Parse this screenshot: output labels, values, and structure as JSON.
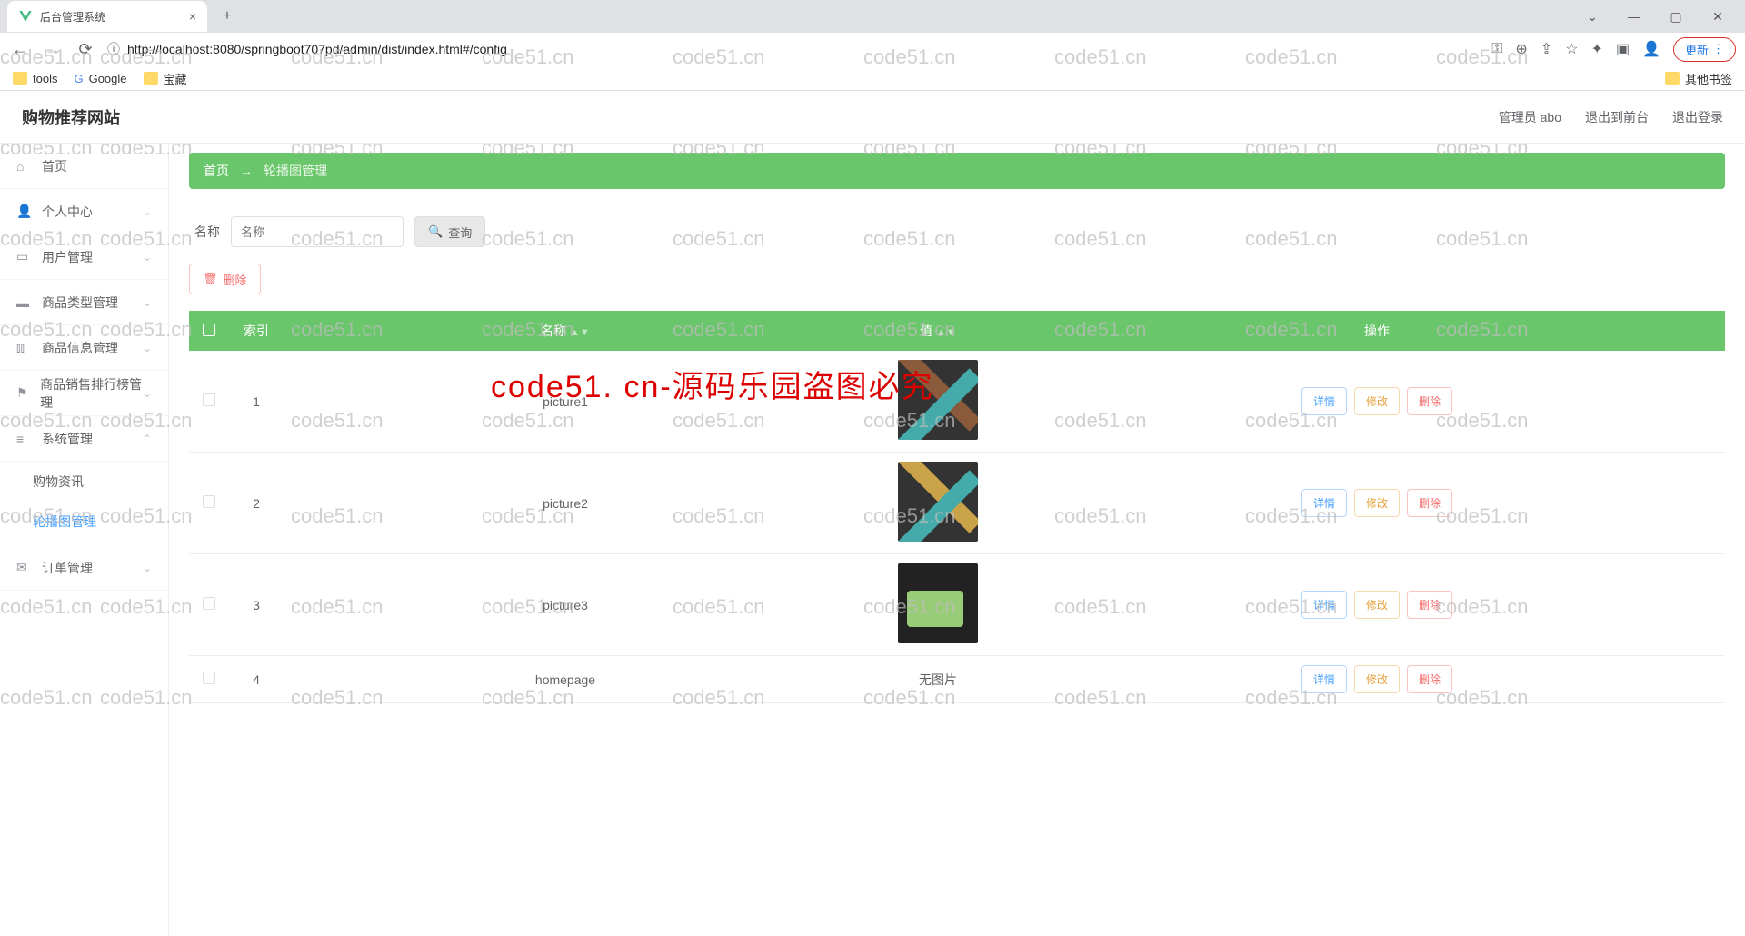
{
  "browser": {
    "tab_title": "后台管理系统",
    "url": "http://localhost:8080/springboot707pd/admin/dist/index.html#/config",
    "update_label": "更新",
    "bookmarks": {
      "tools": "tools",
      "google": "Google",
      "treasure": "宝藏",
      "other": "其他书签"
    }
  },
  "header": {
    "app_title": "购物推荐网站",
    "admin_label": "管理员 abo",
    "exit_front": "退出到前台",
    "logout": "退出登录"
  },
  "sidebar": {
    "home": "首页",
    "personal": "个人中心",
    "user_mgmt": "用户管理",
    "product_type": "商品类型管理",
    "product_info": "商品信息管理",
    "product_rank": "商品销售排行榜管理",
    "system": "系统管理",
    "sub_news": "购物资讯",
    "sub_carousel": "轮播图管理",
    "order": "订单管理"
  },
  "breadcrumb": {
    "home": "首页",
    "current": "轮播图管理"
  },
  "search": {
    "label": "名称",
    "placeholder": "名称",
    "query_btn": "查询"
  },
  "actions": {
    "delete_top": "删除"
  },
  "table": {
    "headers": {
      "index": "索引",
      "name": "名称",
      "value": "值",
      "ops": "操作"
    },
    "row_btns": {
      "detail": "详情",
      "edit": "修改",
      "delete": "删除"
    },
    "rows": [
      {
        "idx": "1",
        "name": "picture1",
        "value_text": ""
      },
      {
        "idx": "2",
        "name": "picture2",
        "value_text": ""
      },
      {
        "idx": "3",
        "name": "picture3",
        "value_text": ""
      },
      {
        "idx": "4",
        "name": "homepage",
        "value_text": "无图片"
      }
    ]
  },
  "overlay": "code51. cn-源码乐园盗图必究",
  "watermark_text": "code51.cn"
}
